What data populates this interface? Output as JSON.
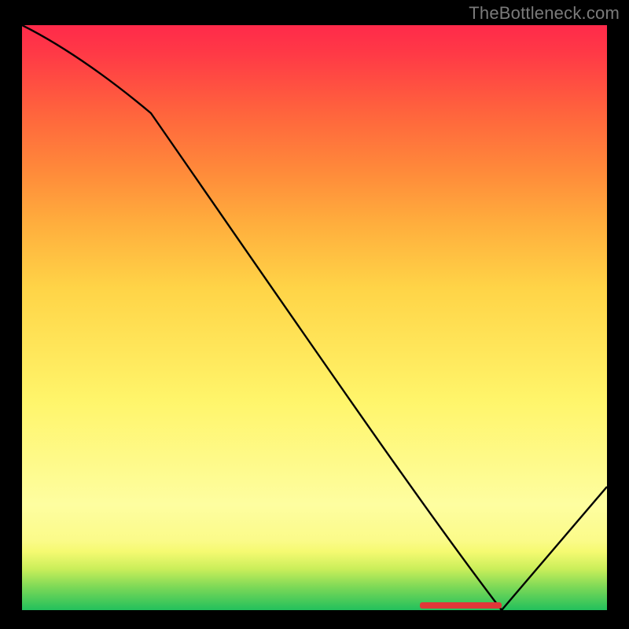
{
  "watermark": "TheBottleneck.com",
  "chart_data": {
    "type": "line",
    "title": "",
    "xlabel": "",
    "ylabel": "",
    "xlim": [
      0,
      100
    ],
    "ylim": [
      0,
      100
    ],
    "x": [
      0,
      22,
      82,
      100
    ],
    "values": [
      100,
      85,
      0,
      21
    ],
    "optimal_range": [
      68,
      82
    ],
    "annotations": [
      "TheBottleneck.com"
    ],
    "background_gradient": [
      "#22c05c",
      "#fefe88",
      "#ff2a4a"
    ]
  }
}
